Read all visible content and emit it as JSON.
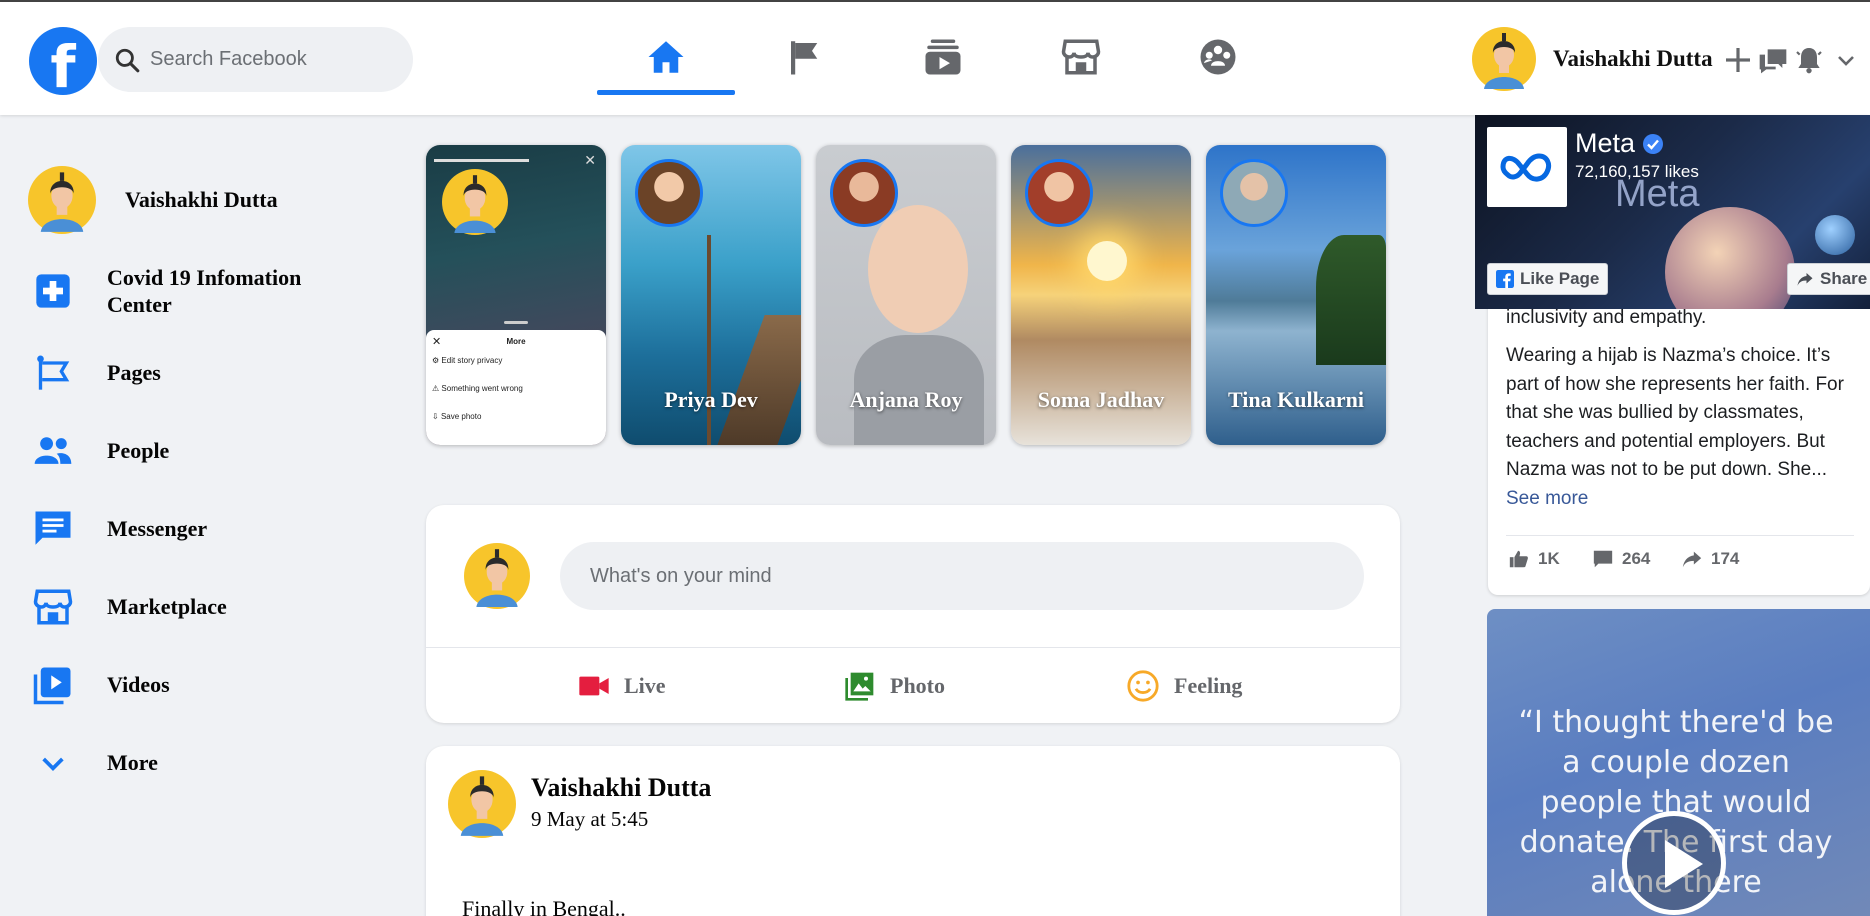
{
  "header": {
    "search_placeholder": "Search Facebook",
    "user_name": "Vaishakhi Dutta",
    "nav_tabs": [
      "home",
      "pages",
      "watch",
      "marketplace",
      "groups"
    ]
  },
  "sidebar": {
    "profile_name": "Vaishakhi Dutta",
    "items": [
      {
        "label": "Covid 19 Infomation Center",
        "icon": "plus-square-icon"
      },
      {
        "label": "Pages",
        "icon": "flag-icon"
      },
      {
        "label": "People",
        "icon": "people-icon"
      },
      {
        "label": "Messenger",
        "icon": "message-icon"
      },
      {
        "label": "Marketplace",
        "icon": "store-icon"
      },
      {
        "label": "Videos",
        "icon": "video-icon"
      },
      {
        "label": "More",
        "icon": "chevron-down-icon"
      }
    ]
  },
  "stories": {
    "menu": {
      "title": "More",
      "items": [
        "Edit story privacy",
        "Something went wrong",
        "Save photo"
      ]
    },
    "items": [
      {
        "name": "Priya Dev"
      },
      {
        "name": "Anjana Roy"
      },
      {
        "name": "Soma Jadhav"
      },
      {
        "name": "Tina Kulkarni"
      }
    ]
  },
  "composer": {
    "placeholder": "What's on your mind",
    "actions": [
      {
        "label": "Live",
        "color": "#e41e3f"
      },
      {
        "label": "Photo",
        "color": "#2e8b2e"
      },
      {
        "label": "Feeling",
        "color": "#f7b928"
      }
    ]
  },
  "post": {
    "author": "Vaishakhi Dutta",
    "time": "9 May at 5:45",
    "text": "Finally in Bengal.."
  },
  "ad": {
    "page_name": "Meta",
    "likes": "72,160,157 likes",
    "brand_word": "Meta",
    "like_button": "Like Page",
    "share_button": "Share",
    "body_lead": "inclusivity and empathy.",
    "body": "Wearing a hijab is Nazma’s choice. It’s part of how she represents her faith. For that she was bullied by classmates, teachers and potential employers. But Nazma was not to be put down. She...",
    "see_more": "See more",
    "likes_count": "1K",
    "comments_count": "264",
    "shares_count": "174"
  },
  "video": {
    "quote": "“I thought there'd be a couple dozen people that would donate. The first day alone there"
  },
  "colors": {
    "brand": "#1877f2",
    "background": "#f0f2f5"
  }
}
